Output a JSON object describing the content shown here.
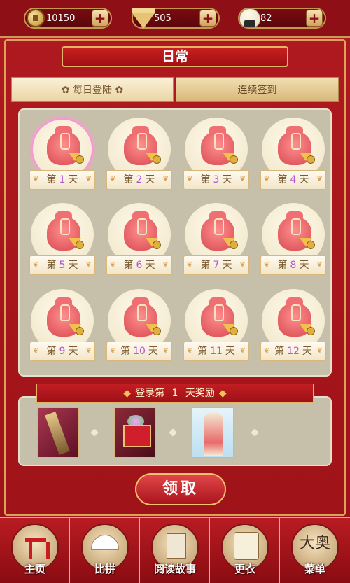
{
  "resources": [
    {
      "name": "coin-icon",
      "value": "10150"
    },
    {
      "name": "diamond-icon",
      "value": "505"
    },
    {
      "name": "rice-ball-icon",
      "value": "82"
    }
  ],
  "plus_label": "+",
  "title": "日常",
  "tabs": [
    {
      "label": "每日登陆",
      "active": true
    },
    {
      "label": "连续签到",
      "active": false
    }
  ],
  "days": [
    {
      "prefix": "第",
      "num": "1",
      "suffix": "天"
    },
    {
      "prefix": "第",
      "num": "2",
      "suffix": "天"
    },
    {
      "prefix": "第",
      "num": "3",
      "suffix": "天"
    },
    {
      "prefix": "第",
      "num": "4",
      "suffix": "天"
    },
    {
      "prefix": "第",
      "num": "5",
      "suffix": "天"
    },
    {
      "prefix": "第",
      "num": "6",
      "suffix": "天"
    },
    {
      "prefix": "第",
      "num": "7",
      "suffix": "天"
    },
    {
      "prefix": "第",
      "num": "8",
      "suffix": "天"
    },
    {
      "prefix": "第",
      "num": "9",
      "suffix": "天"
    },
    {
      "prefix": "第",
      "num": "10",
      "suffix": "天"
    },
    {
      "prefix": "第",
      "num": "11",
      "suffix": "天"
    },
    {
      "prefix": "第",
      "num": "12",
      "suffix": "天"
    }
  ],
  "reward": {
    "prefix": "登录第",
    "day": "1",
    "suffix": "天奖励",
    "items": [
      "hairpin-item",
      "gift-box-item",
      "outfit-item"
    ]
  },
  "claim_label": "领取",
  "nav": [
    {
      "label": "主页",
      "icon": "torii-icon"
    },
    {
      "label": "比拼",
      "icon": "fan-icon"
    },
    {
      "label": "阅读故事",
      "icon": "book-icon"
    },
    {
      "label": "更衣",
      "icon": "robe-icon"
    },
    {
      "label": "菜单",
      "icon": "menu-icon",
      "glyph": "大奥"
    }
  ],
  "colors": {
    "accent": "#a3141b",
    "gold": "#d9a45a",
    "day_number": "#b355d5"
  }
}
